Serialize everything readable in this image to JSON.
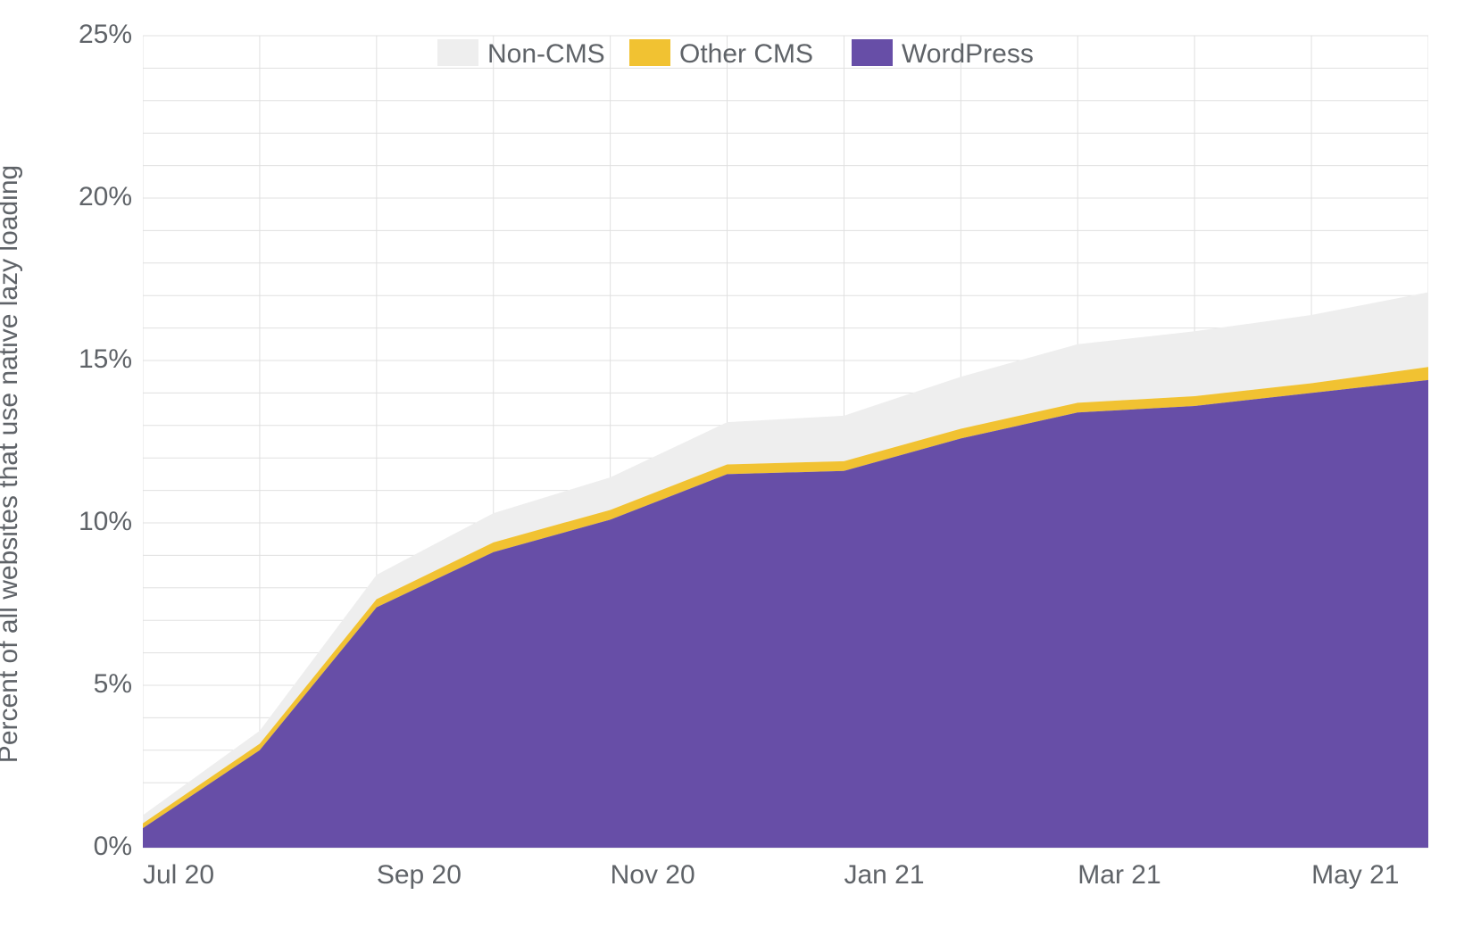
{
  "chart_data": {
    "type": "area",
    "stacked": true,
    "ylabel": "Percent of all websites that use native lazy loading",
    "xlabel": "",
    "ylim": [
      0,
      25
    ],
    "ytick_labels": [
      "0%",
      "5%",
      "10%",
      "15%",
      "20%",
      "25%"
    ],
    "ytick_values": [
      0,
      5,
      10,
      15,
      20,
      25
    ],
    "xtick_labels": [
      "Jul 20",
      "Sep 20",
      "Nov 20",
      "Jan 21",
      "Mar 21",
      "May 21"
    ],
    "xtick_indices": [
      0,
      2,
      4,
      6,
      8,
      10
    ],
    "categories": [
      "Jul 20",
      "Aug 20",
      "Sep 20",
      "Oct 20",
      "Nov 20",
      "Dec 20",
      "Jan 21",
      "Feb 21",
      "Mar 21",
      "Apr 21",
      "May 21",
      "Jun 21"
    ],
    "series": [
      {
        "name": "WordPress",
        "color": "#674ea7",
        "values": [
          0.6,
          3.0,
          7.4,
          9.1,
          10.1,
          11.5,
          11.6,
          12.6,
          13.4,
          13.6,
          14.0,
          14.4
        ]
      },
      {
        "name": "Other CMS",
        "color": "#f1c232",
        "values": [
          0.15,
          0.2,
          0.25,
          0.3,
          0.3,
          0.3,
          0.3,
          0.3,
          0.3,
          0.3,
          0.3,
          0.4
        ]
      },
      {
        "name": "Non-CMS",
        "color": "#eeeeee",
        "values": [
          0.25,
          0.4,
          0.75,
          0.9,
          1.0,
          1.3,
          1.4,
          1.6,
          1.8,
          2.0,
          2.1,
          2.3
        ]
      }
    ],
    "legend_order": [
      "Non-CMS",
      "Other CMS",
      "WordPress"
    ],
    "legend_position": "top"
  }
}
